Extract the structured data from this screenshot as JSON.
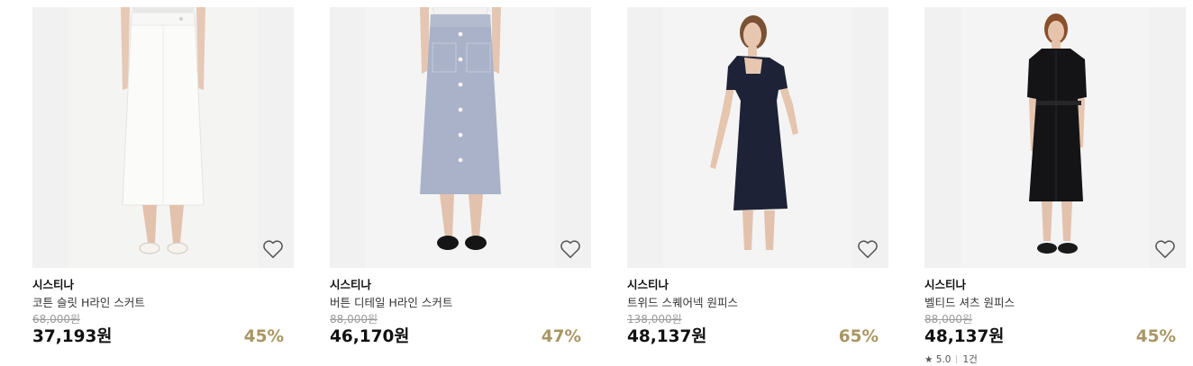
{
  "products": [
    {
      "brand": "시스티나",
      "name": "코튼 슬릿 H라인 스커트",
      "original_price": "68,000원",
      "price": "37,193원",
      "discount": "45%",
      "image": "white-skirt-model"
    },
    {
      "brand": "시스티나",
      "name": "버튼 디테일 H라인 스커트",
      "original_price": "88,000원",
      "price": "46,170원",
      "discount": "47%",
      "image": "blue-button-skirt-model"
    },
    {
      "brand": "시스티나",
      "name": "트위드 스퀘어넥 원피스",
      "original_price": "138,000원",
      "price": "48,137원",
      "discount": "65%",
      "image": "navy-square-neck-dress-model"
    },
    {
      "brand": "시스티나",
      "name": "벨티드 셔츠 원피스",
      "original_price": "88,000원",
      "price": "48,137원",
      "discount": "45%",
      "image": "black-belted-shirt-dress-model",
      "review": {
        "star": "★",
        "rating": "5.0",
        "count": "1건"
      }
    }
  ],
  "colors": {
    "discount": "#a99662",
    "original_price": "#9a9a9a",
    "thumb_bg": "#f1f1f1"
  },
  "icons": {
    "wishlist": "heart-outline-icon"
  }
}
